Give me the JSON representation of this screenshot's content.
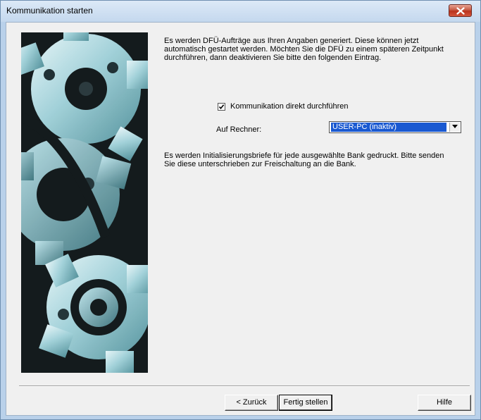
{
  "window": {
    "title": "Kommunikation starten"
  },
  "content": {
    "intro_text": "Es werden DFÜ-Aufträge aus Ihren Angaben generiert. Diese können jetzt automatisch gestartet werden. Möchten Sie die DFÜ zu einem späteren Zeitpunkt durchführen, dann deaktivieren Sie bitte den folgenden Eintrag.",
    "checkbox_label": "Kommunikation direkt durchführen",
    "checkbox_checked": true,
    "rechner_label": "Auf Rechner:",
    "rechner_value": "USER-PC (inaktiv)",
    "info_text": "Es werden Initialisierungsbriefe für jede ausgewählte Bank gedruckt. Bitte senden Sie diese unterschrieben zur Freischaltung an die Bank."
  },
  "buttons": {
    "back": "< Zurück",
    "finish": "Fertig stellen",
    "help": "Hilfe"
  },
  "icons": {
    "close": "close-icon",
    "checkmark": "checkmark-icon",
    "dropdown": "chevron-down-icon",
    "wizard_image": "gears-image"
  },
  "colors": {
    "selection": "#1a59d1",
    "close_button": "#c75a44",
    "dialog_background": "#f0f0f0"
  }
}
